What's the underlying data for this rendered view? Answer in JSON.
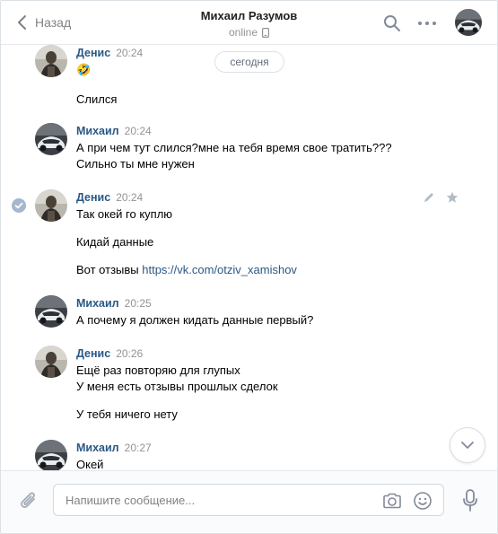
{
  "header": {
    "back_label": "Назад",
    "title": "Михаил Разумов",
    "status": "online"
  },
  "history": {
    "date_label": "сегодня",
    "messages": [
      {
        "author": "Денис",
        "time": "20:24",
        "lines": [
          "🤣",
          "",
          "Слился"
        ]
      },
      {
        "author": "Михаил",
        "time": "20:24",
        "lines": [
          "А при чем тут слился?мне на тебя время свое тратить???",
          "Сильно ты мне нужен"
        ]
      },
      {
        "author": "Денис",
        "time": "20:24",
        "lines": [
          "Так окей го куплю",
          "",
          "Кидай данные",
          "",
          "Вот отзывы "
        ],
        "link": "https://vk.com/otziv_xamishov"
      },
      {
        "author": "Михаил",
        "time": "20:25",
        "lines": [
          "А почему я должен кидать данные первый?"
        ]
      },
      {
        "author": "Денис",
        "time": "20:26",
        "lines": [
          "Ещё раз повторяю для глупых",
          "У меня есть отзывы прошлых сделок",
          "",
          "У тебя ничего нету"
        ]
      },
      {
        "author": "Михаил",
        "time": "20:27",
        "lines": [
          "Окей"
        ]
      }
    ]
  },
  "composer": {
    "placeholder": "Напишите сообщение..."
  },
  "colors": {
    "link": "#2a5885",
    "muted": "#939393",
    "border": "#dce1e6"
  },
  "icons": [
    "back-chevron-icon",
    "phone-icon",
    "search-icon",
    "more-icon",
    "check-icon",
    "pencil-icon",
    "star-icon",
    "chevron-down-icon",
    "paperclip-icon",
    "camera-icon",
    "smile-icon",
    "microphone-icon"
  ]
}
